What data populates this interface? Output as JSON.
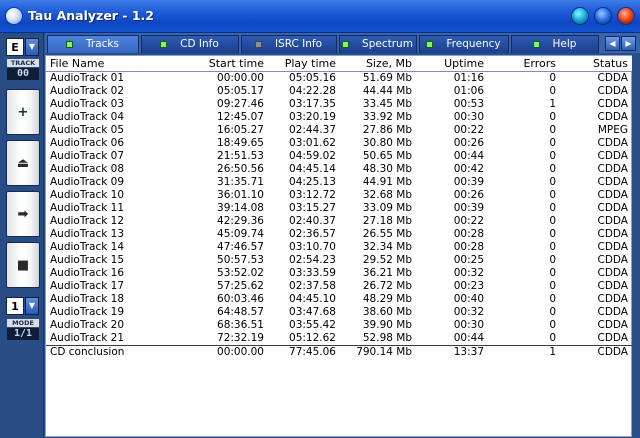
{
  "window": {
    "title": "Tau Analyzer - 1.2"
  },
  "sidebar": {
    "drive_letter": "E",
    "track_label": "TRACK",
    "track_number": "00",
    "buttons": [
      {
        "name": "add",
        "glyph": "+"
      },
      {
        "name": "eject",
        "glyph": "⏏"
      },
      {
        "name": "play",
        "glyph": "➡"
      },
      {
        "name": "stop",
        "glyph": "■"
      }
    ],
    "mode_value": "1",
    "mode_label": "MODE",
    "mode_digits": "1/1"
  },
  "tabs": [
    {
      "label": "Tracks",
      "active": true,
      "dot": "green"
    },
    {
      "label": "CD Info",
      "active": false,
      "dot": "green"
    },
    {
      "label": "ISRC Info",
      "active": false,
      "dot": "grey"
    },
    {
      "label": "Spectrum",
      "active": false,
      "dot": "green"
    },
    {
      "label": "Frequency",
      "active": false,
      "dot": "green"
    },
    {
      "label": "Help",
      "active": false,
      "dot": "green"
    }
  ],
  "table": {
    "columns": [
      "File Name",
      "Start time",
      "Play time",
      "Size, Mb",
      "Uptime",
      "Errors",
      "Status"
    ],
    "rows": [
      [
        "AudioTrack 01",
        "00:00.00",
        "05:05.16",
        "51.69 Mb",
        "01:16",
        "0",
        "CDDA"
      ],
      [
        "AudioTrack 02",
        "05:05.17",
        "04:22.28",
        "44.44 Mb",
        "01:06",
        "0",
        "CDDA"
      ],
      [
        "AudioTrack 03",
        "09:27.46",
        "03:17.35",
        "33.45 Mb",
        "00:53",
        "1",
        "CDDA"
      ],
      [
        "AudioTrack 04",
        "12:45.07",
        "03:20.19",
        "33.92 Mb",
        "00:30",
        "0",
        "CDDA"
      ],
      [
        "AudioTrack 05",
        "16:05.27",
        "02:44.37",
        "27.86 Mb",
        "00:22",
        "0",
        "MPEG"
      ],
      [
        "AudioTrack 06",
        "18:49.65",
        "03:01.62",
        "30.80 Mb",
        "00:26",
        "0",
        "CDDA"
      ],
      [
        "AudioTrack 07",
        "21:51.53",
        "04:59.02",
        "50.65 Mb",
        "00:44",
        "0",
        "CDDA"
      ],
      [
        "AudioTrack 08",
        "26:50.56",
        "04:45.14",
        "48.30 Mb",
        "00:42",
        "0",
        "CDDA"
      ],
      [
        "AudioTrack 09",
        "31:35.71",
        "04:25.13",
        "44.91 Mb",
        "00:39",
        "0",
        "CDDA"
      ],
      [
        "AudioTrack 10",
        "36:01.10",
        "03:12.72",
        "32.68 Mb",
        "00:26",
        "0",
        "CDDA"
      ],
      [
        "AudioTrack 11",
        "39:14.08",
        "03:15.27",
        "33.09 Mb",
        "00:39",
        "0",
        "CDDA"
      ],
      [
        "AudioTrack 12",
        "42:29.36",
        "02:40.37",
        "27.18 Mb",
        "00:22",
        "0",
        "CDDA"
      ],
      [
        "AudioTrack 13",
        "45:09.74",
        "02:36.57",
        "26.55 Mb",
        "00:28",
        "0",
        "CDDA"
      ],
      [
        "AudioTrack 14",
        "47:46.57",
        "03:10.70",
        "32.34 Mb",
        "00:28",
        "0",
        "CDDA"
      ],
      [
        "AudioTrack 15",
        "50:57.53",
        "02:54.23",
        "29.52 Mb",
        "00:25",
        "0",
        "CDDA"
      ],
      [
        "AudioTrack 16",
        "53:52.02",
        "03:33.59",
        "36.21 Mb",
        "00:32",
        "0",
        "CDDA"
      ],
      [
        "AudioTrack 17",
        "57:25.62",
        "02:37.58",
        "26.72 Mb",
        "00:23",
        "0",
        "CDDA"
      ],
      [
        "AudioTrack 18",
        "60:03.46",
        "04:45.10",
        "48.29 Mb",
        "00:40",
        "0",
        "CDDA"
      ],
      [
        "AudioTrack 19",
        "64:48.57",
        "03:47.68",
        "38.60 Mb",
        "00:32",
        "0",
        "CDDA"
      ],
      [
        "AudioTrack 20",
        "68:36.51",
        "03:55.42",
        "39.90 Mb",
        "00:30",
        "0",
        "CDDA"
      ],
      [
        "AudioTrack 21",
        "72:32.19",
        "05:12.62",
        "52.98 Mb",
        "00:44",
        "0",
        "CDDA"
      ]
    ],
    "conclusion": [
      "CD conclusion",
      "00:00.00",
      "77:45.06",
      "790.14 Mb",
      "13:37",
      "1",
      "CDDA"
    ]
  },
  "colors": {
    "titlebar": "#1f5cd8",
    "sidebar": "#284c84",
    "tabbar": "#3b63a8",
    "active_tab": "#4c82de",
    "tab_dot_green": "#7cfa6a"
  }
}
